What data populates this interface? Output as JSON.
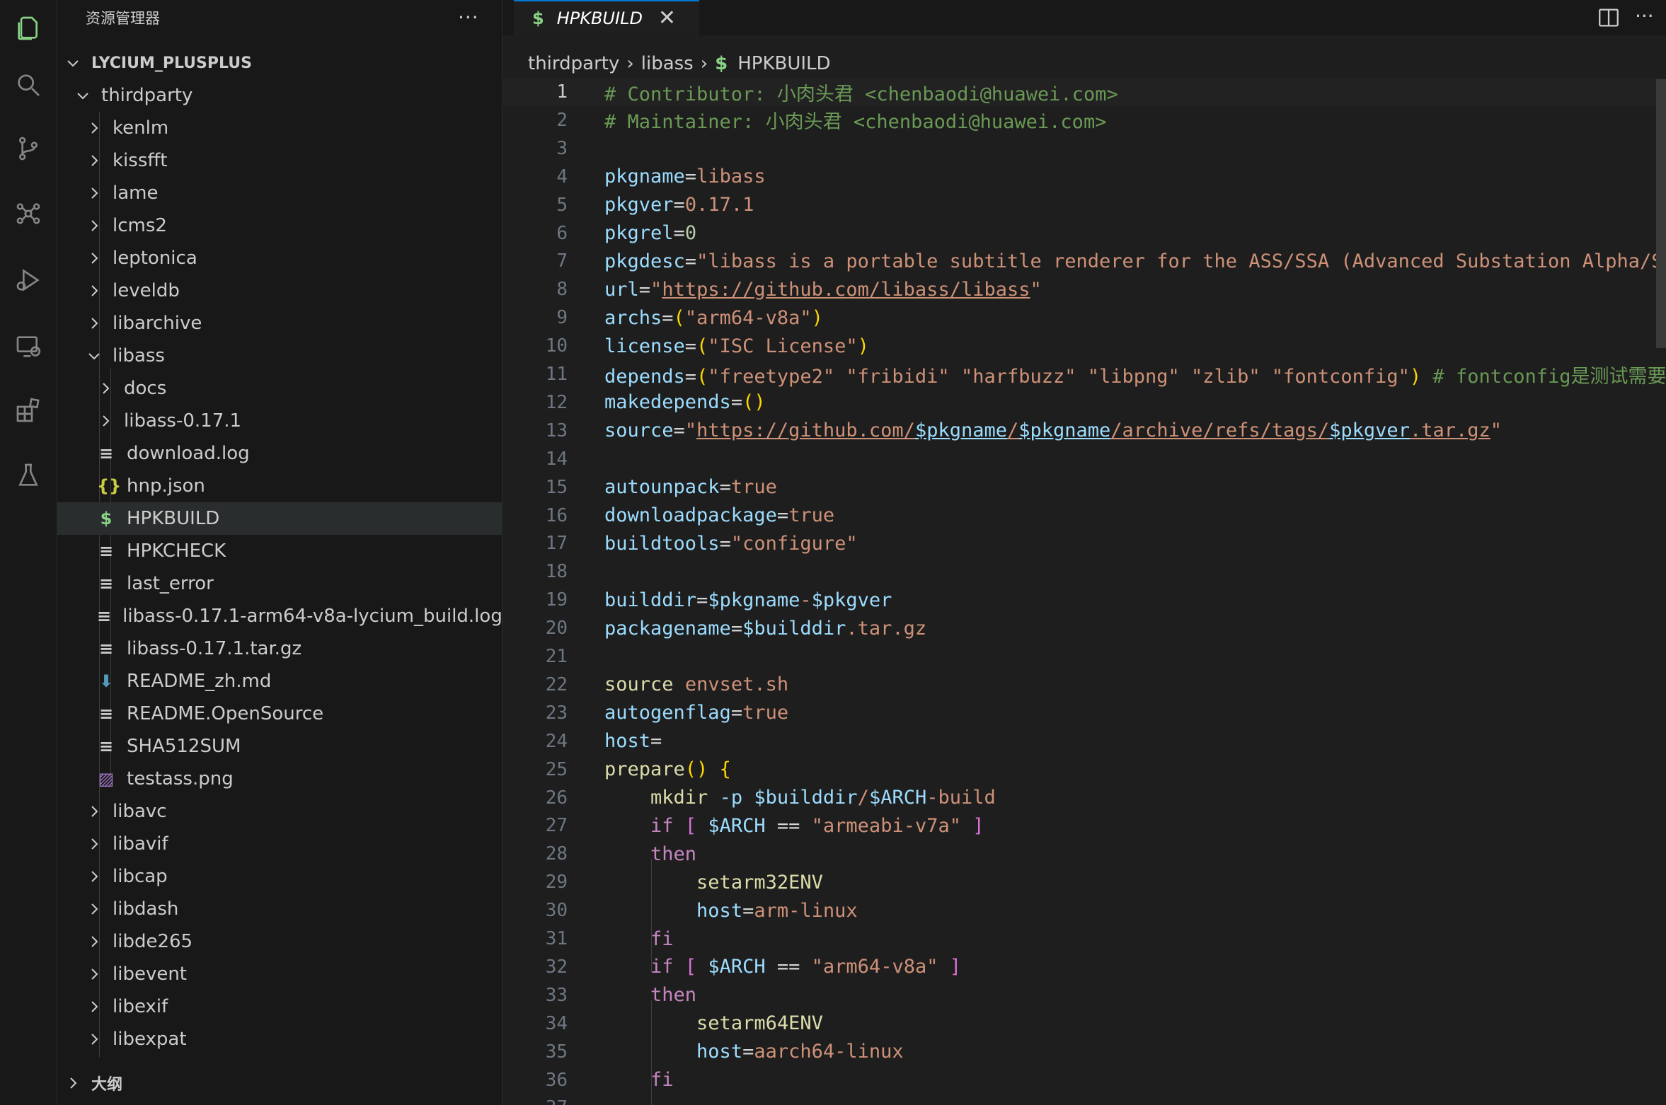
{
  "sidebar": {
    "title": "资源管理器",
    "more": "···",
    "root": "LYCIUM_PLUSPLUS",
    "outline": "大纲",
    "tree": [
      {
        "label": "thirdparty",
        "kind": "folder-open",
        "depth": 1
      },
      {
        "label": "kenlm",
        "kind": "folder",
        "depth": 2
      },
      {
        "label": "kissfft",
        "kind": "folder",
        "depth": 2
      },
      {
        "label": "lame",
        "kind": "folder",
        "depth": 2
      },
      {
        "label": "lcms2",
        "kind": "folder",
        "depth": 2
      },
      {
        "label": "leptonica",
        "kind": "folder",
        "depth": 2
      },
      {
        "label": "leveldb",
        "kind": "folder",
        "depth": 2
      },
      {
        "label": "libarchive",
        "kind": "folder",
        "depth": 2
      },
      {
        "label": "libass",
        "kind": "folder-open",
        "depth": 2
      },
      {
        "label": "docs",
        "kind": "folder",
        "depth": 3
      },
      {
        "label": "libass-0.17.1",
        "kind": "folder",
        "depth": 3
      },
      {
        "label": "download.log",
        "kind": "text",
        "depth": 3
      },
      {
        "label": "hnp.json",
        "kind": "json",
        "depth": 3
      },
      {
        "label": "HPKBUILD",
        "kind": "shell",
        "depth": 3,
        "selected": true
      },
      {
        "label": "HPKCHECK",
        "kind": "text",
        "depth": 3
      },
      {
        "label": "last_error",
        "kind": "text",
        "depth": 3
      },
      {
        "label": "libass-0.17.1-arm64-v8a-lycium_build.log",
        "kind": "text",
        "depth": 3
      },
      {
        "label": "libass-0.17.1.tar.gz",
        "kind": "text",
        "depth": 3
      },
      {
        "label": "README_zh.md",
        "kind": "markdown",
        "depth": 3
      },
      {
        "label": "README.OpenSource",
        "kind": "text",
        "depth": 3
      },
      {
        "label": "SHA512SUM",
        "kind": "text",
        "depth": 3
      },
      {
        "label": "testass.png",
        "kind": "image",
        "depth": 3
      },
      {
        "label": "libavc",
        "kind": "folder",
        "depth": 2
      },
      {
        "label": "libavif",
        "kind": "folder",
        "depth": 2
      },
      {
        "label": "libcap",
        "kind": "folder",
        "depth": 2
      },
      {
        "label": "libdash",
        "kind": "folder",
        "depth": 2
      },
      {
        "label": "libde265",
        "kind": "folder",
        "depth": 2
      },
      {
        "label": "libevent",
        "kind": "folder",
        "depth": 2
      },
      {
        "label": "libexif",
        "kind": "folder",
        "depth": 2
      },
      {
        "label": "libexpat",
        "kind": "folder",
        "depth": 2
      }
    ]
  },
  "tab": {
    "icon": "$",
    "label": "HPKBUILD",
    "close": "✕"
  },
  "tab_more": "···",
  "breadcrumb": {
    "parts": [
      "thirdparty",
      "libass"
    ],
    "file_icon": "$",
    "file": "HPKBUILD"
  },
  "editor": {
    "current_line": 1,
    "lines": [
      [
        [
          "cm",
          "# Contributor: 小肉头君 <chenbaodi@huawei.com>"
        ]
      ],
      [
        [
          "cm",
          "# Maintainer: 小肉头君 <chenbaodi@huawei.com>"
        ]
      ],
      [],
      [
        [
          "va",
          "pkgname"
        ],
        [
          "op",
          "="
        ],
        [
          "st",
          "libass"
        ]
      ],
      [
        [
          "va",
          "pkgver"
        ],
        [
          "op",
          "="
        ],
        [
          "st",
          "0.17.1"
        ]
      ],
      [
        [
          "va",
          "pkgrel"
        ],
        [
          "op",
          "="
        ],
        [
          "nm",
          "0"
        ]
      ],
      [
        [
          "va",
          "pkgdesc"
        ],
        [
          "op",
          "="
        ],
        [
          "st",
          "\"libass is a portable subtitle renderer for the ASS/SSA (Advanced Substation Alpha/Substation Alpha) subtitle format\""
        ]
      ],
      [
        [
          "va",
          "url"
        ],
        [
          "op",
          "="
        ],
        [
          "st",
          "\""
        ],
        [
          "st ul",
          "https://github.com/libass/libass"
        ],
        [
          "st",
          "\""
        ]
      ],
      [
        [
          "va",
          "archs"
        ],
        [
          "op",
          "="
        ],
        [
          "br1",
          "("
        ],
        [
          "st",
          "\"arm64-v8a\""
        ],
        [
          "br1",
          ")"
        ]
      ],
      [
        [
          "va",
          "license"
        ],
        [
          "op",
          "="
        ],
        [
          "br1",
          "("
        ],
        [
          "st",
          "\"ISC License\""
        ],
        [
          "br1",
          ")"
        ]
      ],
      [
        [
          "va",
          "depends"
        ],
        [
          "op",
          "="
        ],
        [
          "br1",
          "("
        ],
        [
          "st",
          "\"freetype2\" \"fribidi\" \"harfbuzz\" \"libpng\" \"zlib\" \"fontconfig\""
        ],
        [
          "br1",
          ")"
        ],
        [
          "cm",
          " # fontconfig是测试需要"
        ]
      ],
      [
        [
          "va",
          "makedepends"
        ],
        [
          "op",
          "="
        ],
        [
          "br1",
          "()"
        ]
      ],
      [
        [
          "va",
          "source"
        ],
        [
          "op",
          "="
        ],
        [
          "st",
          "\""
        ],
        [
          "st ul",
          "https://github.com/"
        ],
        [
          "va ul",
          "$pkgname"
        ],
        [
          "st ul",
          "/"
        ],
        [
          "va ul",
          "$pkgname"
        ],
        [
          "st ul",
          "/archive/refs/tags/"
        ],
        [
          "va ul",
          "$pkgver"
        ],
        [
          "st ul",
          ".tar.gz"
        ],
        [
          "st",
          "\""
        ]
      ],
      [],
      [
        [
          "va",
          "autounpack"
        ],
        [
          "op",
          "="
        ],
        [
          "st",
          "true"
        ]
      ],
      [
        [
          "va",
          "downloadpackage"
        ],
        [
          "op",
          "="
        ],
        [
          "st",
          "true"
        ]
      ],
      [
        [
          "va",
          "buildtools"
        ],
        [
          "op",
          "="
        ],
        [
          "st",
          "\"configure\""
        ]
      ],
      [],
      [
        [
          "va",
          "builddir"
        ],
        [
          "op",
          "="
        ],
        [
          "va",
          "$pkgname"
        ],
        [
          "st",
          "-"
        ],
        [
          "va",
          "$pkgver"
        ]
      ],
      [
        [
          "va",
          "packagename"
        ],
        [
          "op",
          "="
        ],
        [
          "va",
          "$builddir"
        ],
        [
          "st",
          ".tar.gz"
        ]
      ],
      [],
      [
        [
          "fn",
          "source"
        ],
        [
          "op",
          " "
        ],
        [
          "st",
          "envset.sh"
        ]
      ],
      [
        [
          "va",
          "autogenflag"
        ],
        [
          "op",
          "="
        ],
        [
          "st",
          "true"
        ]
      ],
      [
        [
          "va",
          "host"
        ],
        [
          "op",
          "="
        ]
      ],
      [
        [
          "fn",
          "prepare"
        ],
        [
          "br1",
          "()"
        ],
        [
          "op",
          " "
        ],
        [
          "br1",
          "{"
        ]
      ],
      [
        [
          "op",
          "    "
        ],
        [
          "fn",
          "mkdir"
        ],
        [
          "op",
          " "
        ],
        [
          "va",
          "-p"
        ],
        [
          "op",
          " "
        ],
        [
          "va",
          "$builddir"
        ],
        [
          "st",
          "/"
        ],
        [
          "va",
          "$ARCH"
        ],
        [
          "st",
          "-build"
        ]
      ],
      [
        [
          "op",
          "    "
        ],
        [
          "kw",
          "if"
        ],
        [
          "op",
          " "
        ],
        [
          "br2",
          "["
        ],
        [
          "op",
          " "
        ],
        [
          "va",
          "$ARCH"
        ],
        [
          "op",
          " == "
        ],
        [
          "st",
          "\"armeabi-v7a\""
        ],
        [
          "op",
          " "
        ],
        [
          "br2",
          "]"
        ]
      ],
      [
        [
          "op",
          "    "
        ],
        [
          "kw",
          "then"
        ]
      ],
      [
        [
          "op",
          "        "
        ],
        [
          "fn",
          "setarm32ENV"
        ]
      ],
      [
        [
          "op",
          "        "
        ],
        [
          "va",
          "host"
        ],
        [
          "op",
          "="
        ],
        [
          "st",
          "arm-linux"
        ]
      ],
      [
        [
          "op",
          "    "
        ],
        [
          "kw",
          "fi"
        ]
      ],
      [
        [
          "op",
          "    "
        ],
        [
          "kw",
          "if"
        ],
        [
          "op",
          " "
        ],
        [
          "br2",
          "["
        ],
        [
          "op",
          " "
        ],
        [
          "va",
          "$ARCH"
        ],
        [
          "op",
          " == "
        ],
        [
          "st",
          "\"arm64-v8a\""
        ],
        [
          "op",
          " "
        ],
        [
          "br2",
          "]"
        ]
      ],
      [
        [
          "op",
          "    "
        ],
        [
          "kw",
          "then"
        ]
      ],
      [
        [
          "op",
          "        "
        ],
        [
          "fn",
          "setarm64ENV"
        ]
      ],
      [
        [
          "op",
          "        "
        ],
        [
          "va",
          "host"
        ],
        [
          "op",
          "="
        ],
        [
          "st",
          "aarch64-linux"
        ]
      ],
      [
        [
          "op",
          "    "
        ],
        [
          "kw",
          "fi"
        ]
      ],
      []
    ]
  },
  "colors": {
    "accent": "#0078d4",
    "shell_icon": "#89d185",
    "json_icon": "#cbcb41",
    "markdown_icon": "#519aba",
    "image_icon": "#a074c4"
  }
}
